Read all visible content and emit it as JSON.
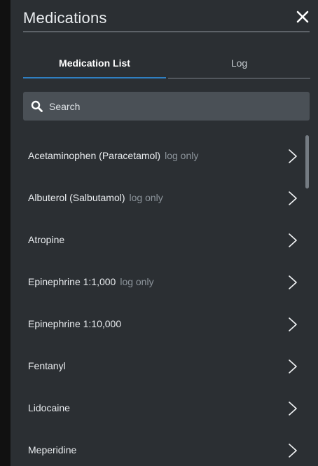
{
  "header": {
    "title": "Medications",
    "close_icon": "close-icon"
  },
  "tabs": [
    {
      "label": "Medication List",
      "active": true
    },
    {
      "label": "Log",
      "active": false
    }
  ],
  "search": {
    "placeholder": "Search",
    "icon": "search-icon"
  },
  "medications": [
    {
      "name": "Acetaminophen (Paracetamol)",
      "tag": "log only"
    },
    {
      "name": "Albuterol (Salbutamol)",
      "tag": "log only"
    },
    {
      "name": "Atropine",
      "tag": ""
    },
    {
      "name": "Epinephrine 1:1,000",
      "tag": "log only"
    },
    {
      "name": "Epinephrine 1:10,000",
      "tag": ""
    },
    {
      "name": "Fentanyl",
      "tag": ""
    },
    {
      "name": "Lidocaine",
      "tag": ""
    },
    {
      "name": "Meperidine",
      "tag": ""
    }
  ],
  "colors": {
    "panel_bg": "#2b2f33",
    "accent": "#2f7fc1",
    "search_bg": "#4a5056",
    "muted_text": "#8d959c"
  }
}
